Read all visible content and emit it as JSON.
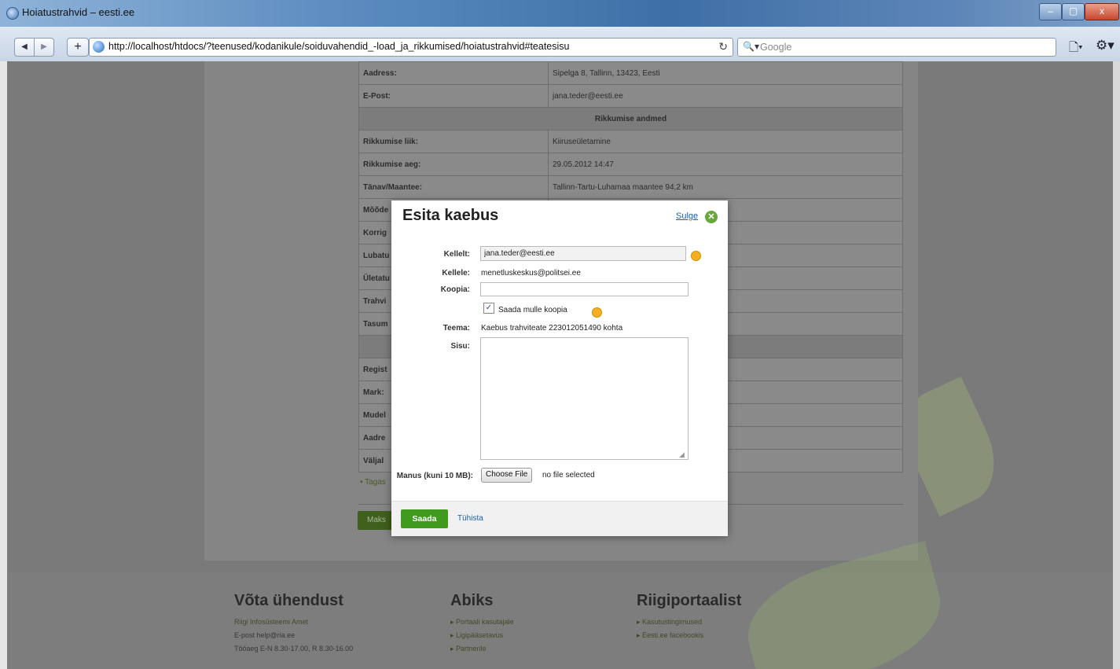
{
  "browser": {
    "window_title": "Hoiatustrahvid – eesti.ee",
    "url": "http://localhost/htdocs/?teenused/kodanikule/soiduvahendid_-load_ja_rikkumised/hoiatustrahvid#teatesisu",
    "search_placeholder": "Google",
    "window_controls": {
      "minimize": "–",
      "maximize": "▢",
      "close": "x"
    }
  },
  "table": {
    "rows": [
      {
        "label": "Aadress:",
        "value": "Sipelga 8, Tallinn, 13423, Eesti"
      },
      {
        "label": "E-Post:",
        "value": "jana.teder@eesti.ee"
      },
      {
        "section": "Rikkumise andmed"
      },
      {
        "label": "Rikkumise liik:",
        "value": "Kiiruseületamine"
      },
      {
        "label": "Rikkumise aeg:",
        "value": "29.05.2012 14:47"
      },
      {
        "label": "Tänav/Maantee:",
        "value": "Tallinn-Tartu-Luhamaa maantee 94,2 km"
      },
      {
        "label": "Mõõde",
        "value": ""
      },
      {
        "label": "Korrig",
        "value": ""
      },
      {
        "label": "Lubatu",
        "value": ""
      },
      {
        "label": "Ületatu",
        "value": ""
      },
      {
        "label": "Trahvi",
        "value": ""
      },
      {
        "label": "Tasum",
        "value": ""
      },
      {
        "section": ""
      },
      {
        "label": "Regist",
        "value": ""
      },
      {
        "label": "Mark:",
        "value": ""
      },
      {
        "label": "Mudel",
        "value": ""
      },
      {
        "label": "Aadre",
        "value": ""
      },
      {
        "label": "Väljal",
        "value": ""
      }
    ],
    "back_link": "• Tagas",
    "pay_button": "Maks"
  },
  "footer": {
    "contact": {
      "title": "Võta ühendust",
      "lines": [
        "Riigi Infosüsteemi Amet",
        "E-post help@ria.ee",
        "Tööaeg E-N 8.30-17.00, R 8.30-16.00"
      ]
    },
    "help": {
      "title": "Abiks",
      "lines": [
        "Portaali kasutajale",
        "Ligipääsetavus",
        "Partnerile"
      ]
    },
    "portal": {
      "title": "Riigiportaalist",
      "lines": [
        "Kasutustingimused",
        "Eesti.ee facebookis"
      ]
    }
  },
  "dialog": {
    "title": "Esita kaebus",
    "close_label": "Sulge",
    "from_label": "Kellelt:",
    "from_value": "jana.teder@eesti.ee",
    "to_label": "Kellele:",
    "to_value": "menetluskeskus@politsei.ee",
    "cc_label": "Koopia:",
    "cc_value": "",
    "copy_checkbox_label": "Saada mulle koopia",
    "copy_checked": true,
    "subject_label": "Teema:",
    "subject_value": "Kaebus trahviteate 223012051490 kohta",
    "body_label": "Sisu:",
    "attachment_label": "Manus (kuni 10 MB):",
    "choose_file_label": "Choose File",
    "no_file_text": "no file selected",
    "send_button": "Saada",
    "cancel_link": "Tühista"
  }
}
